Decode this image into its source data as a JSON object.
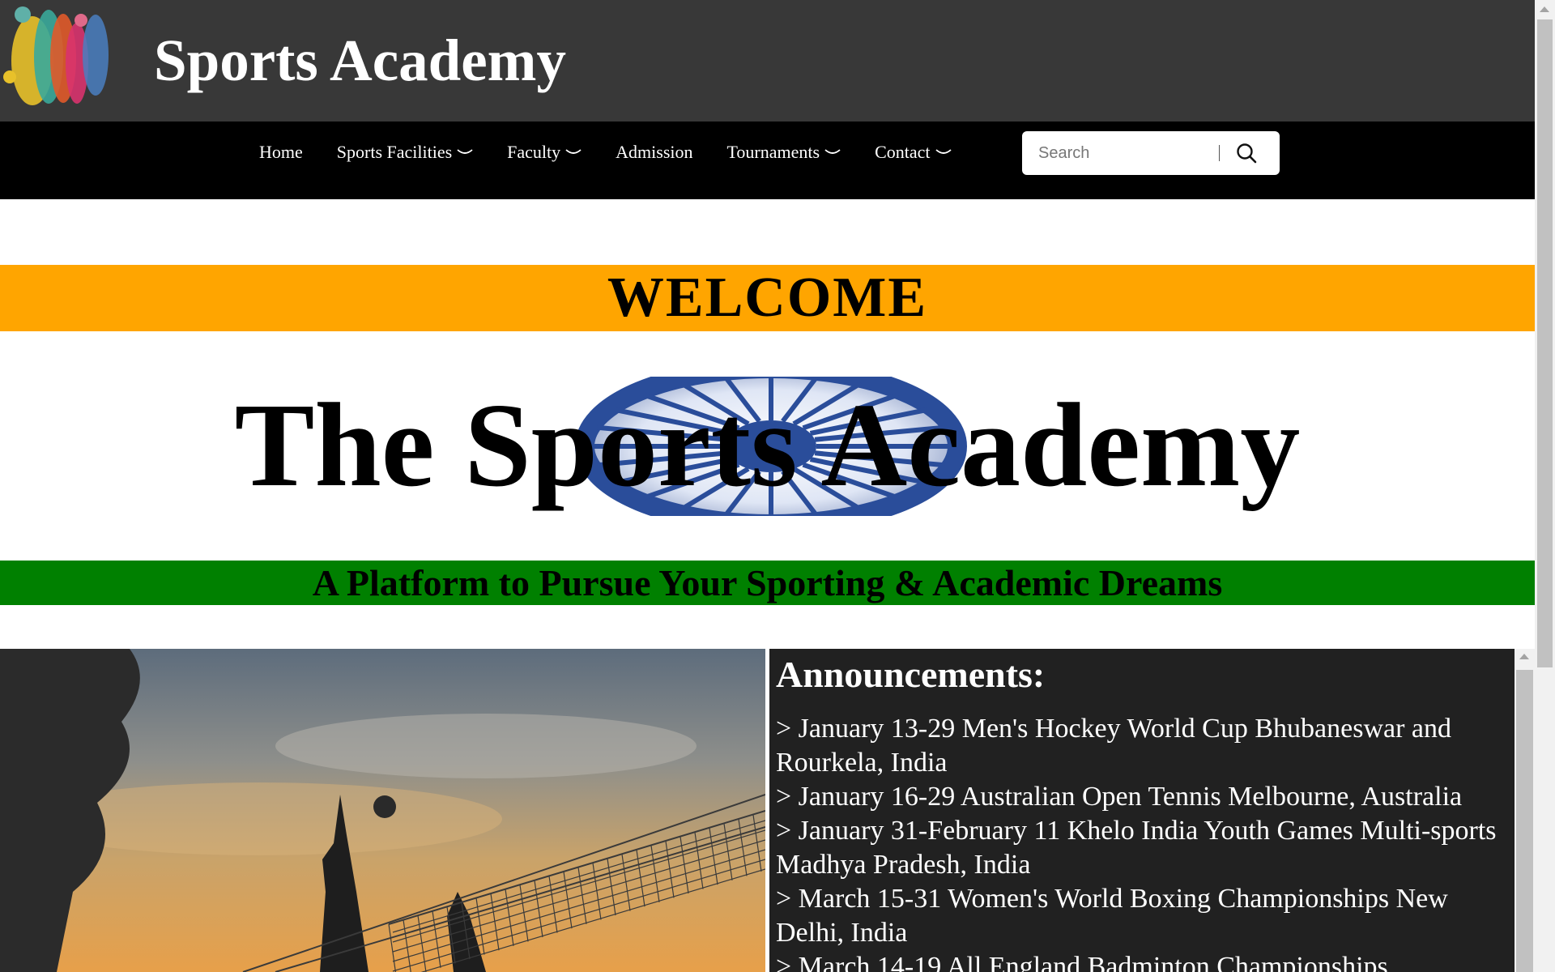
{
  "header": {
    "site_title": "Sports Academy"
  },
  "nav": {
    "items": [
      {
        "label": "Home",
        "has_dropdown": false
      },
      {
        "label": "Sports Facilities",
        "has_dropdown": true
      },
      {
        "label": "Faculty",
        "has_dropdown": true
      },
      {
        "label": "Admission",
        "has_dropdown": false
      },
      {
        "label": "Tournaments",
        "has_dropdown": true
      },
      {
        "label": "Contact",
        "has_dropdown": true
      }
    ],
    "search_placeholder": "Search"
  },
  "hero": {
    "welcome": "WELCOME",
    "title": "The Sports Academy",
    "tagline": "A Platform to Pursue Your Sporting & Academic Dreams"
  },
  "announcements": {
    "title": "Announcements:",
    "items": [
      "> January 13-29 Men's Hockey World Cup Bhubaneswar and Rourkela, India",
      "> January 16-29 Australian Open Tennis Melbourne, Australia",
      "> January 31-February 11 Khelo India Youth Games Multi-sports Madhya Pradesh, India",
      "> March 15-31 Women's World Boxing Championships New Delhi, India",
      "> March 14-19 All England Badminton Championships"
    ]
  },
  "colors": {
    "header_bg": "#383838",
    "nav_bg": "#000000",
    "welcome_bg": "#ffa500",
    "tagline_bg": "#008000",
    "announcements_bg": "#212121",
    "chakra": "#2a4d9a"
  },
  "icons": {
    "search": "search-icon",
    "dropdown": "chevron-down-icon"
  }
}
